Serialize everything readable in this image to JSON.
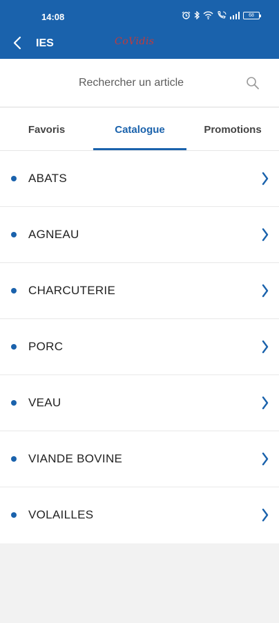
{
  "status_bar": {
    "time": "14:08",
    "battery": "68",
    "icons": [
      "alarm-icon",
      "bluetooth-icon",
      "wifi-icon",
      "wifi-call-icon",
      "signal-icon",
      "battery-icon"
    ]
  },
  "app_bar": {
    "title": "IES",
    "logo_text": "CoVidis",
    "back_icon": "back-arrow-icon",
    "color": "#1a62ac"
  },
  "search": {
    "placeholder": "Rechercher un article",
    "value": "",
    "icon": "search-icon"
  },
  "tabs": [
    {
      "label": "Favoris",
      "active": false
    },
    {
      "label": "Catalogue",
      "active": true
    },
    {
      "label": "Promotions",
      "active": false
    }
  ],
  "categories": [
    {
      "label": "ABATS"
    },
    {
      "label": "AGNEAU"
    },
    {
      "label": "CHARCUTERIE"
    },
    {
      "label": "PORC"
    },
    {
      "label": "VEAU"
    },
    {
      "label": "VIANDE BOVINE"
    },
    {
      "label": "VOLAILLES"
    }
  ],
  "colors": {
    "accent": "#1a62ac",
    "background": "#f2f2f2",
    "logo": "#c33a3a"
  }
}
